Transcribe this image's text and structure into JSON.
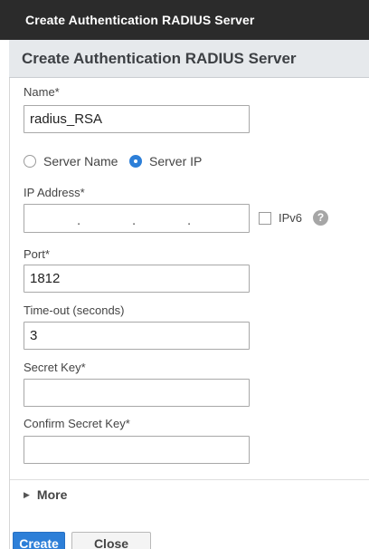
{
  "window": {
    "title": "Create Authentication RADIUS Server"
  },
  "dialog": {
    "title": "Create Authentication RADIUS Server",
    "name": {
      "label": "Name*",
      "value": "radius_RSA"
    },
    "server_type": {
      "options": [
        {
          "label": "Server Name",
          "selected": false
        },
        {
          "label": "Server IP",
          "selected": true
        }
      ]
    },
    "ip_address": {
      "label": "IP Address*",
      "dots": ".",
      "value": ""
    },
    "ipv6": {
      "label": "IPv6",
      "checked": false,
      "help_glyph": "?"
    },
    "port": {
      "label": "Port*",
      "value": "1812"
    },
    "timeout": {
      "label": "Time-out (seconds)",
      "value": "3"
    },
    "secret_key": {
      "label": "Secret Key*",
      "value": ""
    },
    "confirm_secret_key": {
      "label": "Confirm Secret Key*",
      "value": ""
    },
    "more": {
      "label": "More",
      "icon": "triangle-right-icon"
    },
    "buttons": {
      "create": "Create",
      "close": "Close"
    }
  },
  "colors": {
    "accent": "#2d7fd8",
    "titlebar": "#2b2b2b",
    "header": "#e6e9ec"
  }
}
